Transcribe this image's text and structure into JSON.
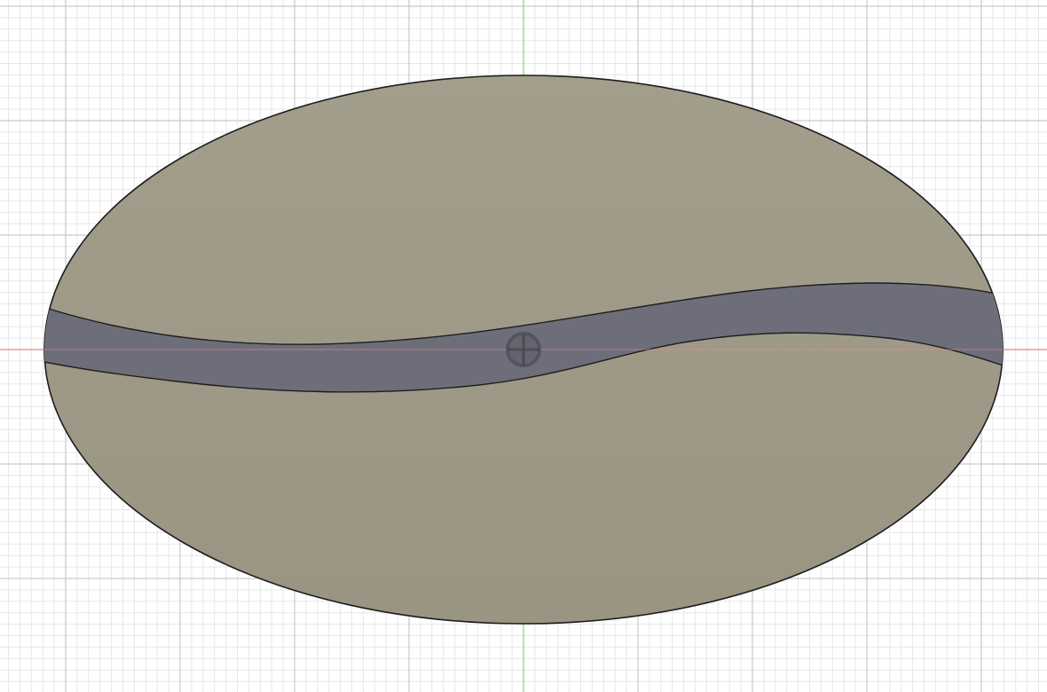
{
  "viewport": {
    "background_color": "#ffffff",
    "minor_grid_color": "#e7e7e7",
    "major_grid_color": "#c9c9c9",
    "x_axis_color": "#f08a8a",
    "y_axis_color": "#7fe07f"
  },
  "sketch": {
    "shape": "ellipse",
    "body_color": "#9e9886",
    "slot_color": "#6d6e7a",
    "outline_color": "#1e1e1e",
    "origin_marker": "origin-point-icon"
  }
}
